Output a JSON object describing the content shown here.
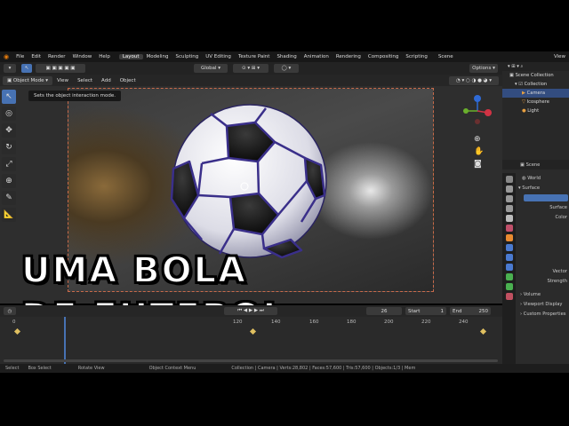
{
  "menu": {
    "items": [
      "File",
      "Edit",
      "Render",
      "Window",
      "Help"
    ],
    "workspaces": [
      "Layout",
      "Modeling",
      "Sculpting",
      "UV Editing",
      "Texture Paint",
      "Shading",
      "Animation",
      "Rendering",
      "Compositing",
      "Scripting"
    ],
    "active_workspace": "Layout",
    "scene_label": "Scene",
    "view_label": "View"
  },
  "toolbar": {
    "orientation": "Global",
    "options": "Options"
  },
  "viewport_header": {
    "mode": "Object Mode",
    "menus": [
      "View",
      "Select",
      "Add",
      "Object"
    ]
  },
  "tooltip": "Sets the object interaction mode.",
  "overlay_title": {
    "line1": "UMA BOLA",
    "line2": "DE FUTEBOL"
  },
  "outliner": {
    "root": "Scene Collection",
    "items": [
      {
        "label": "Collection",
        "selected": false
      },
      {
        "label": "Camera",
        "selected": true
      },
      {
        "label": "Icosphere",
        "selected": false
      },
      {
        "label": "Light",
        "selected": false
      }
    ]
  },
  "properties": {
    "scene": "Scene",
    "world": "World",
    "surface_section": "Surface",
    "surface_label": "Surface",
    "color_label": "Color",
    "vector_label": "Vector",
    "strength_label": "Strength",
    "panels": [
      "Volume",
      "Viewport Display",
      "Custom Properties"
    ]
  },
  "timeline": {
    "current_frame": "26",
    "start_label": "Start",
    "start": "1",
    "end_label": "End",
    "end": "250",
    "ticks": [
      "0",
      "120",
      "140",
      "160",
      "180",
      "200",
      "220",
      "240"
    ]
  },
  "statusbar": {
    "items": [
      "Select",
      "Box Select",
      "Rotate View",
      "Object Context Menu",
      "Collection | Camera | Verts:28,802 | Faces:57,600 | Tris:57,600 | Objects:1/3 | Mem"
    ]
  },
  "colors": {
    "accent": "#4772b3",
    "camera_frame": "#c86a4a",
    "ball_seam": "#3a2f8a"
  }
}
